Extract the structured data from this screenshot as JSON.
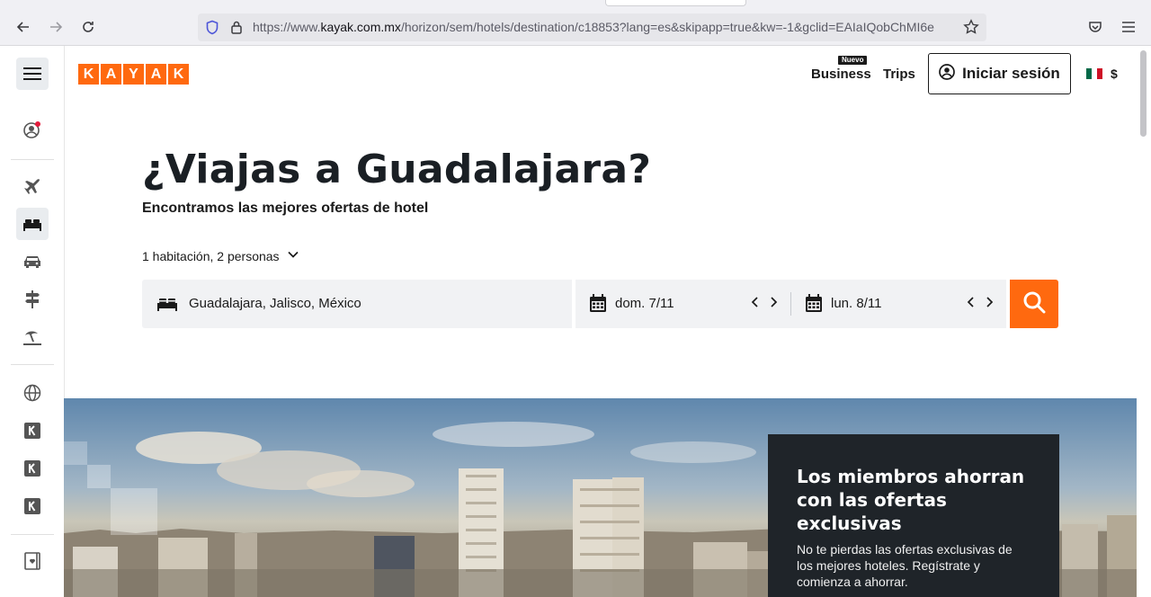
{
  "browser": {
    "url_prefix": "https://www.",
    "url_host": "kayak.com.mx",
    "url_path": "/horizon/sem/hotels/destination/c18853?lang=es&skipapp=true&kw=-1&gclid=EAIaIQobChMI6e"
  },
  "header": {
    "logo_letters": [
      "K",
      "A",
      "Y",
      "A",
      "K"
    ],
    "business_label": "Business",
    "new_badge": "Nuevo",
    "trips_label": "Trips",
    "signin_label": "Iniciar sesión",
    "currency": "$"
  },
  "hero": {
    "title": "¿Viajas a Guadalajara?",
    "subtitle": "Encontramos las mejores ofertas de hotel",
    "guests": "1 habitación, 2 personas"
  },
  "search": {
    "destination": "Guadalajara, Jalisco, México",
    "checkin": "dom. 7/11",
    "checkout": "lun. 8/11"
  },
  "promo": {
    "title": "Los miembros ahorran con las ofertas exclusivas",
    "body": "No te pierdas las ofertas exclusivas de los mejores hoteles. Regístrate y comienza a ahorrar."
  },
  "colors": {
    "brand": "#ff690f",
    "dark": "#1f2429"
  }
}
